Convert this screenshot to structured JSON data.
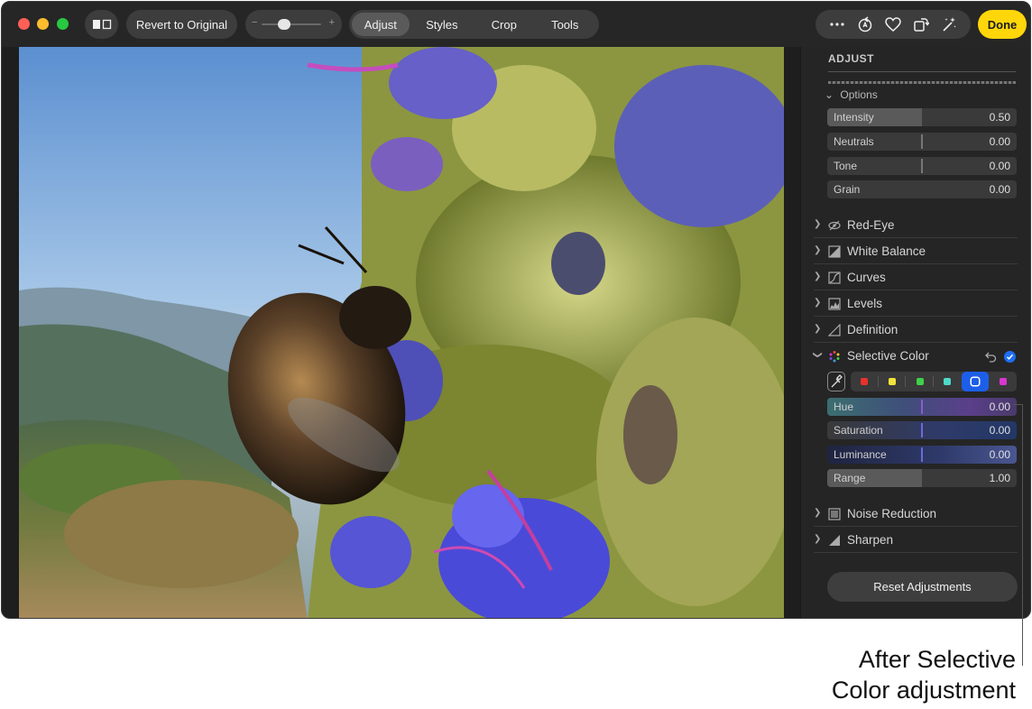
{
  "toolbar": {
    "revert_label": "Revert to Original",
    "zoom": {
      "minus": "−",
      "plus": "+",
      "level": 0.38
    },
    "tabs": [
      {
        "label": "Adjust",
        "active": true
      },
      {
        "label": "Styles",
        "active": false
      },
      {
        "label": "Crop",
        "active": false
      },
      {
        "label": "Tools",
        "active": false
      }
    ],
    "actions": [
      "more-icon",
      "rotate-ai-icon",
      "heart-icon",
      "rotate-icon",
      "magic-wand-icon"
    ],
    "done_label": "Done"
  },
  "sidebar": {
    "title": "ADJUST",
    "options_label": "Options",
    "options": [
      {
        "label": "Intensity",
        "value": "0.50",
        "level": 0.5
      },
      {
        "label": "Neutrals",
        "value": "0.00",
        "level": 0.0
      },
      {
        "label": "Tone",
        "value": "0.00",
        "level": 0.0
      },
      {
        "label": "Grain",
        "value": "0.00",
        "level": 0.0
      }
    ],
    "sections": [
      {
        "label": "Red-Eye",
        "icon": "eye-slash-icon"
      },
      {
        "label": "White Balance",
        "icon": "white-balance-icon"
      },
      {
        "label": "Curves",
        "icon": "curves-icon"
      },
      {
        "label": "Levels",
        "icon": "levels-icon"
      },
      {
        "label": "Definition",
        "icon": "definition-icon"
      },
      {
        "label": "Selective Color",
        "icon": "selective-color-icon"
      }
    ],
    "selective_color": {
      "swatches": [
        "#e8322b",
        "#f3e23b",
        "#3fd14a",
        "#4fd9c9",
        "#1d5ee8",
        "#d936d0"
      ],
      "selected_swatch": 4,
      "sliders": [
        {
          "label": "Hue",
          "value": "0.00",
          "level": 0.5
        },
        {
          "label": "Saturation",
          "value": "0.00",
          "level": 0.5
        },
        {
          "label": "Luminance",
          "value": "0.00",
          "level": 0.5
        },
        {
          "label": "Range",
          "value": "1.00",
          "level": 0.5
        }
      ]
    },
    "bottom_sections": [
      {
        "label": "Noise Reduction",
        "icon": "noise-icon"
      },
      {
        "label": "Sharpen",
        "icon": "sharpen-icon"
      }
    ],
    "reset_label": "Reset Adjustments"
  },
  "callout": {
    "line1": "After Selective",
    "line2": "Color adjustment"
  }
}
